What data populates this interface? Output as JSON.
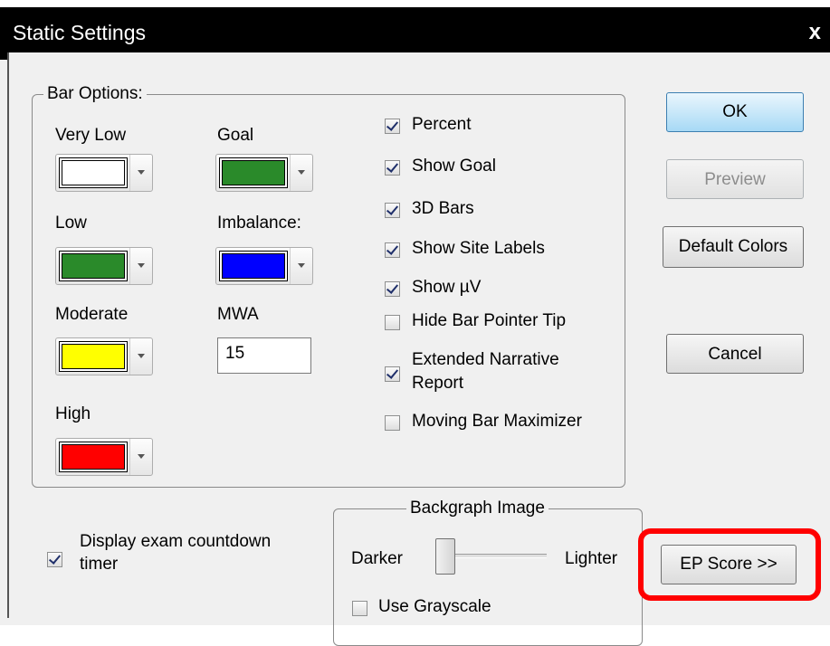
{
  "window": {
    "title": "Static Settings",
    "close_glyph": "x"
  },
  "bar_options": {
    "legend": "Bar Options:",
    "very_low": {
      "label": "Very Low",
      "color": "#ffffff"
    },
    "goal": {
      "label": "Goal",
      "color": "#2a8a2a"
    },
    "low": {
      "label": "Low",
      "color": "#2a8a2a"
    },
    "imbalance": {
      "label": "Imbalance:",
      "color": "#0000ff"
    },
    "moderate": {
      "label": "Moderate",
      "color": "#ffff00"
    },
    "mwa": {
      "label": "MWA",
      "value": "15"
    },
    "high": {
      "label": "High",
      "color": "#ff0000"
    },
    "checkboxes": [
      {
        "label": "Percent",
        "checked": true
      },
      {
        "label": "Show Goal",
        "checked": true
      },
      {
        "label": "3D Bars",
        "checked": true
      },
      {
        "label": "Show Site Labels",
        "checked": true
      },
      {
        "label": "Show µV",
        "checked": true
      },
      {
        "label": "Hide Bar Pointer Tip",
        "checked": false
      },
      {
        "label_line1": "Extended Narrative",
        "label_line2": "Report",
        "checked": true
      },
      {
        "label": "Moving Bar Maximizer",
        "checked": false
      }
    ]
  },
  "buttons": {
    "ok": "OK",
    "preview": "Preview",
    "default_colors": "Default Colors",
    "cancel": "Cancel",
    "ep_score": "EP Score >>"
  },
  "countdown": {
    "line1": "Display exam countdown",
    "line2": "timer",
    "checked": true
  },
  "backgraph": {
    "legend": "Backgraph Image",
    "darker": "Darker",
    "lighter": "Lighter",
    "slider_level": 0,
    "use_grayscale": "Use Grayscale",
    "grayscale_checked": false
  },
  "annotation": {
    "highlight_color": "#ff0000"
  }
}
